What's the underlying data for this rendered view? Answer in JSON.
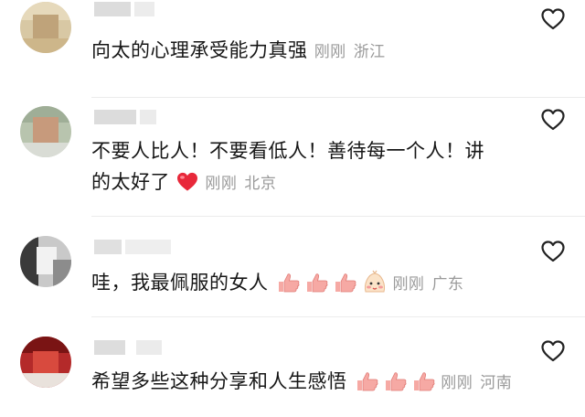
{
  "comments": [
    {
      "text": "向太的心理承受能力真强",
      "time": "刚刚",
      "location": "浙江",
      "emoji": ""
    },
    {
      "text_line1": "不要人比人！不要看低人！善待每一个人！讲",
      "text_line2": "的太好了",
      "time": "刚刚",
      "location": "北京",
      "emoji": "red-heart"
    },
    {
      "text": "哇，我最佩服的女人",
      "time": "刚刚",
      "location": "广东",
      "emoji": "thumbs-up x3, blushing-face"
    },
    {
      "text": "希望多些这种分享和人生感悟",
      "time": "刚刚",
      "location": "河南",
      "emoji": "thumbs-up x3"
    }
  ],
  "icons": {
    "like": "heart-outline-icon"
  },
  "colors": {
    "text": "#161616",
    "meta": "#9a9a9a",
    "heart_emoji": "#e8283a",
    "thumb": "#f6a9a4"
  }
}
